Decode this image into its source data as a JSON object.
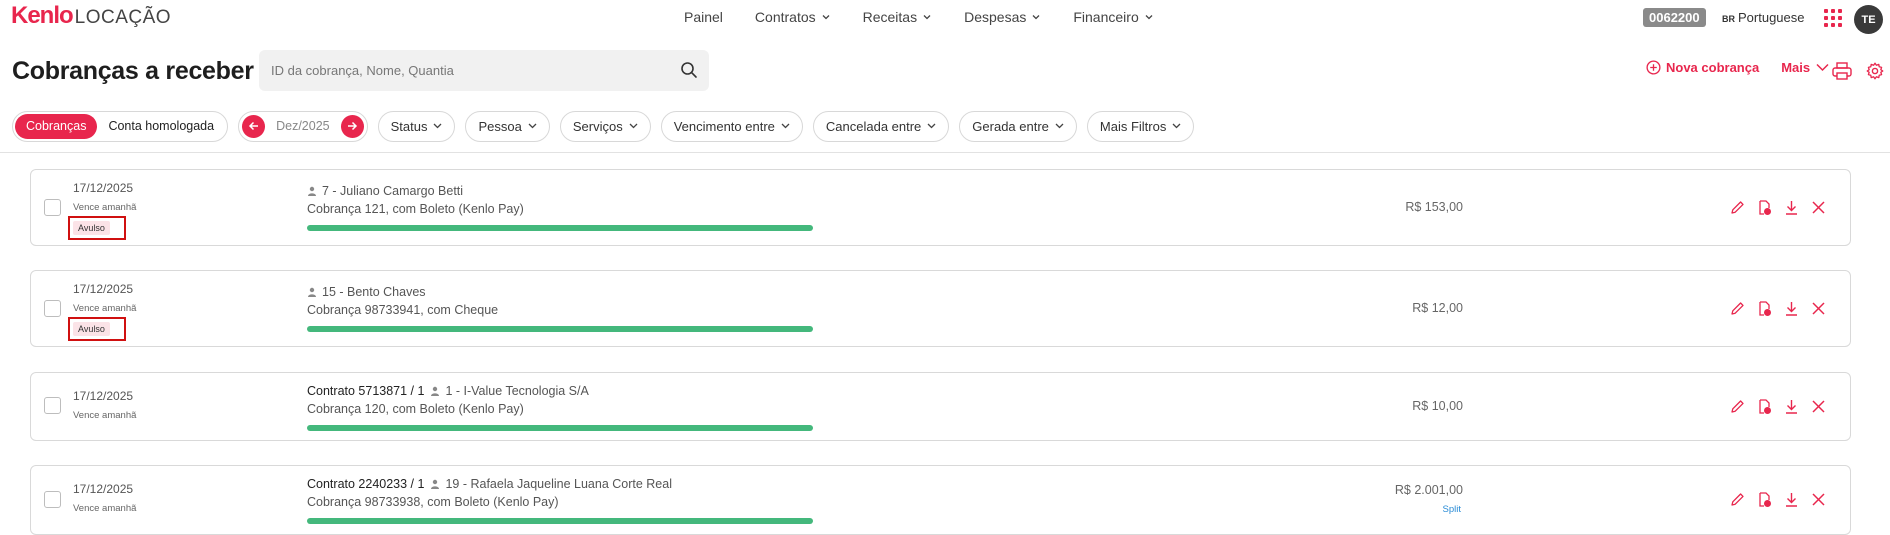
{
  "app": {
    "logo_brand": "Kenlo",
    "logo_product": "LOCAÇÃO",
    "accent_color": "#e8264d"
  },
  "nav": {
    "items": [
      {
        "label": "Painel",
        "has_dropdown": false
      },
      {
        "label": "Contratos",
        "has_dropdown": true
      },
      {
        "label": "Receitas",
        "has_dropdown": true
      },
      {
        "label": "Despesas",
        "has_dropdown": true
      },
      {
        "label": "Financeiro",
        "has_dropdown": true
      }
    ],
    "account_code": "0062200",
    "language_flag": "BR",
    "language": "Portuguese",
    "avatar_initials": "TE"
  },
  "header": {
    "title": "Cobranças a receber",
    "search_placeholder": "ID da cobrança, Nome, Quantia",
    "search_value": "",
    "new_charge_label": "Nova cobrança",
    "more_label": "Mais"
  },
  "filters": {
    "segments": [
      {
        "label": "Cobranças",
        "active": true
      },
      {
        "label": "Conta homologada",
        "active": false
      }
    ],
    "month": "Dez/2025",
    "pills": [
      "Status",
      "Pessoa",
      "Serviços",
      "Vencimento entre",
      "Cancelada entre",
      "Gerada entre",
      "Mais Filtros"
    ]
  },
  "charges": [
    {
      "date": "17/12/2025",
      "due_note": "Vence amanhã",
      "tag": "Avulso",
      "contract": "",
      "person": "7 - Juliano Camargo Betti",
      "description": "Cobrança 121, com Boleto (Kenlo Pay)",
      "progress": 1.0,
      "amount": "R$ 153,00",
      "note": ""
    },
    {
      "date": "17/12/2025",
      "due_note": "Vence amanhã",
      "tag": "Avulso",
      "contract": "",
      "person": "15 - Bento Chaves",
      "description": "Cobrança 98733941, com Cheque",
      "progress": 1.0,
      "amount": "R$ 12,00",
      "note": ""
    },
    {
      "date": "17/12/2025",
      "due_note": "Vence amanhã",
      "tag": "",
      "contract": "Contrato 5713871 / 1",
      "person": "1 - I-Value Tecnologia S/A",
      "description": "Cobrança 120, com Boleto (Kenlo Pay)",
      "progress": 1.0,
      "amount": "R$ 10,00",
      "note": ""
    },
    {
      "date": "17/12/2025",
      "due_note": "Vence amanhã",
      "tag": "",
      "contract": "Contrato 2240233 / 1",
      "person": "19 - Rafaela Jaqueline Luana Corte Real",
      "description": "Cobrança 98733938, com Boleto (Kenlo Pay)",
      "progress": 1.0,
      "amount": "R$ 2.001,00",
      "note": "Split"
    }
  ]
}
